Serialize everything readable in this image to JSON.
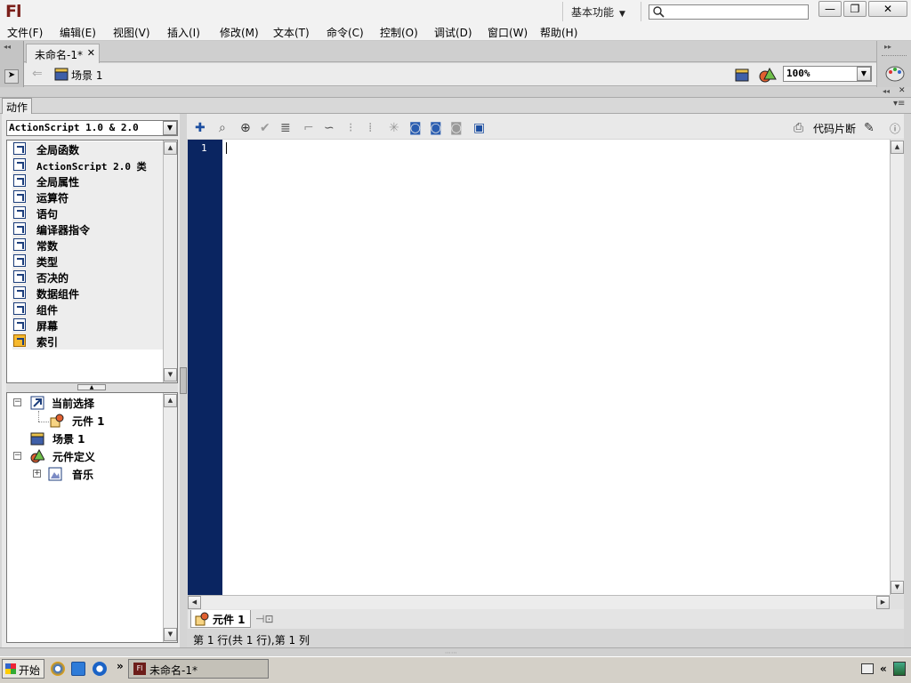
{
  "app": {
    "logo_text": "Fl",
    "workspace_label": "基本功能",
    "search_placeholder": "",
    "window_buttons": {
      "minimize": "—",
      "restore": "❐",
      "close": "✕"
    }
  },
  "menu": [
    "文件(F)",
    "编辑(E)",
    "视图(V)",
    "插入(I)",
    "修改(M)",
    "文本(T)",
    "命令(C)",
    "控制(O)",
    "调试(D)",
    "窗口(W)",
    "帮助(H)"
  ],
  "document": {
    "tab_title": "未命名-1*",
    "tab_close": "✕",
    "scene_name": "场景 1",
    "zoom": "100%"
  },
  "actions_panel": {
    "tab_label": "动作",
    "version_select": "ActionScript 1.0 & 2.0",
    "toolbox_items": [
      "全局函数",
      "ActionScript 2.0 类",
      "全局属性",
      "运算符",
      "语句",
      "编译器指令",
      "常数",
      "类型",
      "否决的",
      "数据组件",
      "组件",
      "屏幕",
      "索引"
    ],
    "script_tree": {
      "current_selection": "当前选择",
      "current_symbol": "元件 1",
      "scene": "场景 1",
      "symbol_definitions": "元件定义",
      "music": "音乐"
    },
    "toolbar": {
      "snippets_label": "代码片断"
    },
    "editor": {
      "line_number": "1",
      "code": ""
    },
    "script_tab": "元件 1",
    "status": "第 1 行(共 1 行),第 1 列"
  },
  "taskbar": {
    "start_label": "开始",
    "task_item": "未命名-1*",
    "overflow": "»"
  },
  "colors": {
    "gutter": "#0a2561",
    "logo": "#7b1f1a"
  }
}
